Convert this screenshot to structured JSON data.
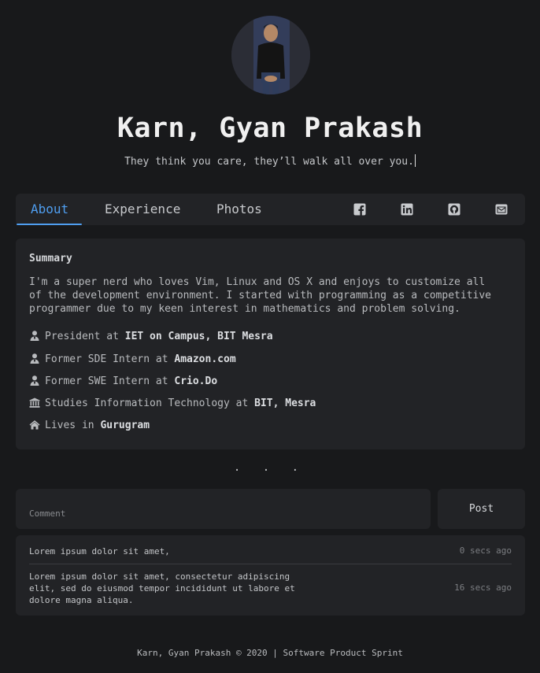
{
  "profile": {
    "name": "Karn, Gyan Prakash",
    "tagline": "They think you care, they’ll walk all over you."
  },
  "tabs": [
    {
      "label": "About",
      "active": true
    },
    {
      "label": "Experience",
      "active": false
    },
    {
      "label": "Photos",
      "active": false
    }
  ],
  "social": [
    "facebook-icon",
    "linkedin-icon",
    "github-icon",
    "email-icon"
  ],
  "about": {
    "summary_title": "Summary",
    "summary_text": "I'm a super nerd who loves Vim, Linux and OS X and enjoys to customize all of the development environment. I started with programming as a competitive programmer due to my keen interest in mathematics and problem solving.",
    "facts": [
      {
        "icon": "user-tie-icon",
        "prefix": "President at",
        "highlight": "IET on Campus, BIT Mesra"
      },
      {
        "icon": "user-tie-icon",
        "prefix": "Former SDE Intern at",
        "highlight": "Amazon.com"
      },
      {
        "icon": "user-tie-icon",
        "prefix": "Former SWE Intern at",
        "highlight": "Crio.Do"
      },
      {
        "icon": "university-icon",
        "prefix": "Studies Information Technology at",
        "highlight": "BIT, Mesra"
      },
      {
        "icon": "home-icon",
        "prefix": "Lives in",
        "highlight": "Gurugram"
      }
    ]
  },
  "separator": ". . .",
  "comment_form": {
    "placeholder": "Comment",
    "post_label": "Post"
  },
  "comments": [
    {
      "text": "Lorem ipsum dolor sit amet,",
      "time": "0 secs ago"
    },
    {
      "text": "Lorem ipsum dolor sit amet, consectetur adipiscing elit, sed do eiusmod tempor incididunt ut labore et dolore magna aliqua.",
      "time": "16 secs ago"
    }
  ],
  "footer": "Karn, Gyan Prakash © 2020 | Software Product Sprint",
  "colors": {
    "accent": "#4f9ef0",
    "background": "#18191b",
    "card": "#222326"
  }
}
